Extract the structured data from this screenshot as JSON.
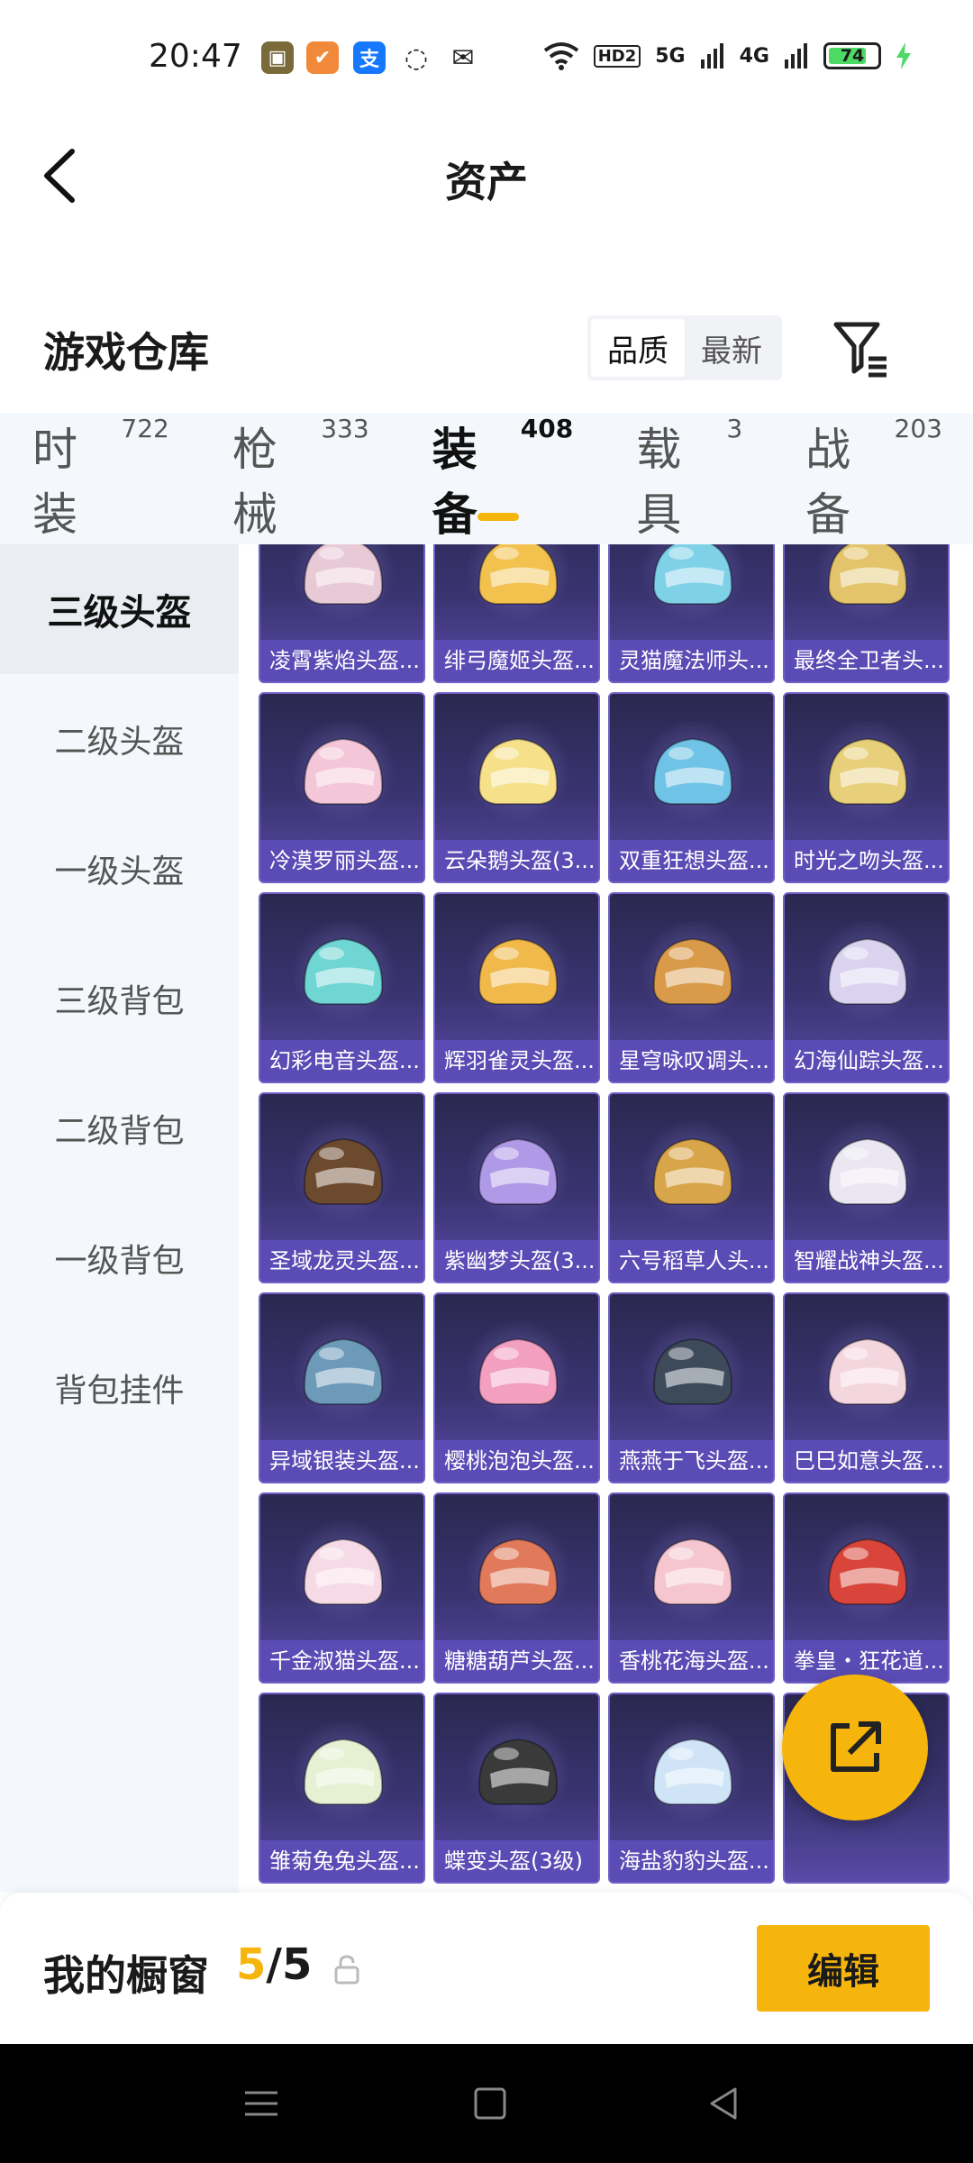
{
  "status_bar": {
    "time": "20:47",
    "network_hd": "HD2",
    "net_5g": "5G",
    "net_4g": "4G",
    "battery": "74",
    "icons": [
      "game-app-icon",
      "orange-app-icon",
      "alipay-icon",
      "chat-icon",
      "mail-icon",
      "wifi-icon",
      "signal-icon",
      "charging-icon"
    ]
  },
  "header": {
    "title": "资产"
  },
  "warehouse": {
    "title": "游戏仓库",
    "sort_options": [
      "品质",
      "最新"
    ],
    "active_sort": "品质"
  },
  "tabs": [
    {
      "label": "时装",
      "count": "722"
    },
    {
      "label": "枪械",
      "count": "333"
    },
    {
      "label": "装备",
      "count": "408",
      "active": true
    },
    {
      "label": "载具",
      "count": "3"
    },
    {
      "label": "战备",
      "count": "203"
    }
  ],
  "side_nav": [
    "三级头盔",
    "二级头盔",
    "一级头盔",
    "三级背包",
    "二级背包",
    "一级背包",
    "背包挂件"
  ],
  "items": [
    "凌霄紫焰头盔...",
    "绯弓魔姬头盔...",
    "灵猫魔法师头...",
    "最终全卫者头...",
    "冷漠罗丽头盔...",
    "云朵鹅头盔(3...",
    "双重狂想头盔...",
    "时光之吻头盔...",
    "幻彩电音头盔...",
    "辉羽雀灵头盔...",
    "星穹咏叹调头...",
    "幻海仙踪头盔...",
    "圣域龙灵头盔...",
    "紫幽梦头盔(3...",
    "六号稻草人头...",
    "智耀战神头盔...",
    "异域银装头盔...",
    "樱桃泡泡头盔...",
    "燕燕于飞头盔...",
    "巳巳如意头盔...",
    "千金淑猫头盔...",
    "糖糖葫芦头盔...",
    "香桃花海头盔...",
    "拳皇・狂花道...",
    "雏菊兔兔头盔...",
    "蝶变头盔(3级)",
    "海盐豹豹头盔...",
    "",
    "",
    "",
    "",
    ""
  ],
  "item_colors": [
    "#e8c9d6",
    "#f2c14e",
    "#7fd1e8",
    "#e3c46b",
    "#f3c6d8",
    "#f7e08a",
    "#6fc3e6",
    "#e8cf7a",
    "#6fd6d4",
    "#f0b94a",
    "#d99b4a",
    "#d9d3ef",
    "#6b4a2e",
    "#b09ae8",
    "#d9a54a",
    "#eae6f2",
    "#6c9ab8",
    "#f29fc0",
    "#3d4a5a",
    "#f4d6df",
    "#f6dbe6",
    "#e07a5a",
    "#f5c6cf",
    "#d9453b",
    "#e6f0d2",
    "#3a3a3a",
    "#cfe4f7",
    "#2d2d2d",
    "#f1e7c4",
    "#c8323a",
    "#3a5a6a",
    "#d9383a"
  ],
  "showcase": {
    "label": "我的橱窗",
    "current": "5",
    "sep": "/",
    "total": "5",
    "edit_label": "编辑"
  }
}
